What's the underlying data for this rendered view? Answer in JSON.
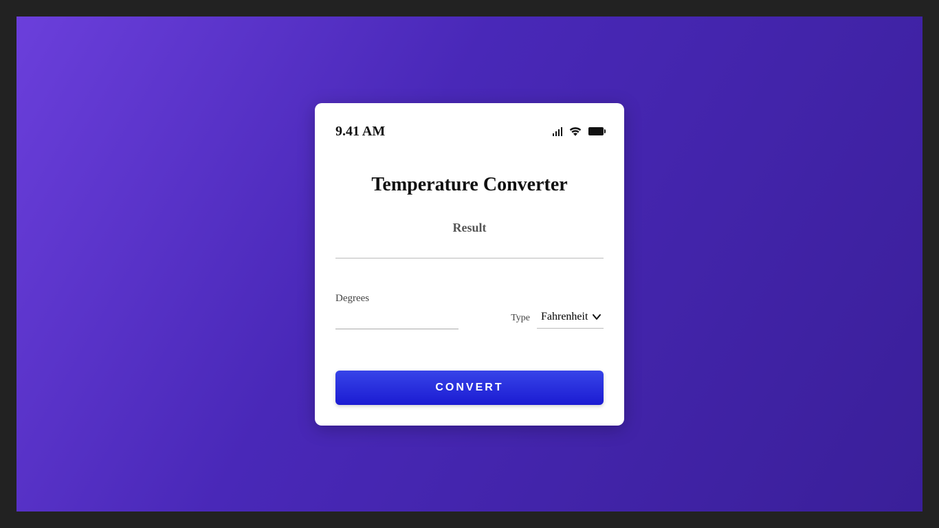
{
  "statusBar": {
    "time": "9.41 AM"
  },
  "title": "Temperature Converter",
  "result": {
    "label": "Result",
    "value": ""
  },
  "form": {
    "degrees_label": "Degrees",
    "degrees_value": "",
    "type_label": "Type",
    "type_selected": "Fahrenheit"
  },
  "button": {
    "convert_label": "CONVERT"
  }
}
